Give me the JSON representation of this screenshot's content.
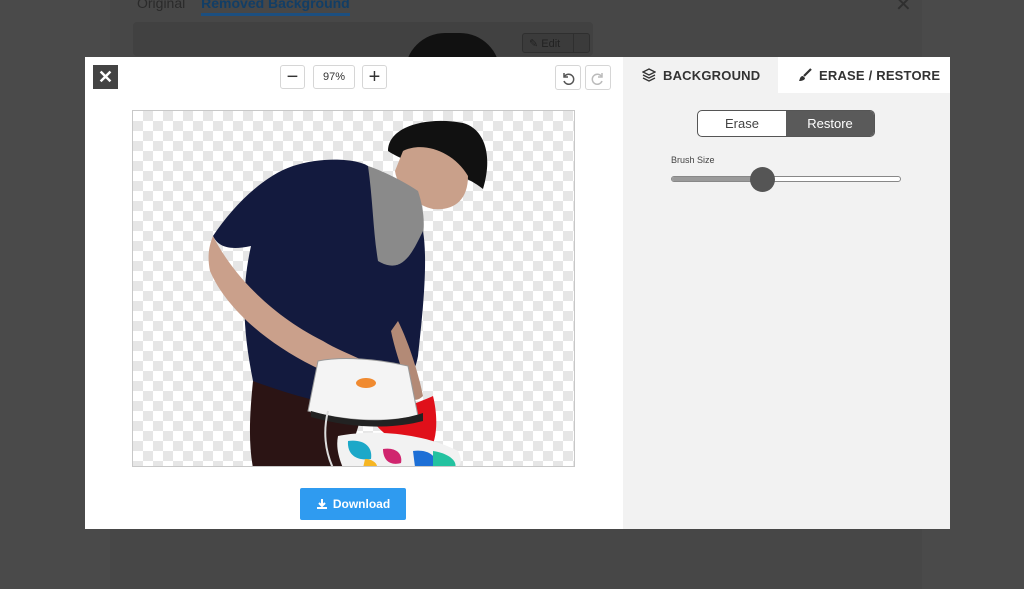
{
  "background_page": {
    "tabs": [
      "Original",
      "Removed Background"
    ],
    "active_tab": "Removed Background",
    "edit_label": "Edit"
  },
  "toolbar": {
    "close_icon": "close-icon",
    "zoom_out": "−",
    "zoom_value": "97%",
    "zoom_in": "+",
    "undo_icon": "undo-icon",
    "redo_icon": "redo-icon"
  },
  "download_label": "Download",
  "panel": {
    "tabs": [
      {
        "label": "BACKGROUND",
        "icon": "layers-icon",
        "active": false
      },
      {
        "label": "ERASE / RESTORE",
        "icon": "brush-icon",
        "active": true
      }
    ],
    "mode": {
      "erase": "Erase",
      "restore": "Restore",
      "selected": "Restore"
    },
    "brush_size_label": "Brush Size",
    "brush_size_level": 0.39
  },
  "colors": {
    "accent": "#2f9bf0",
    "active_mode": "#5a5a5a"
  }
}
